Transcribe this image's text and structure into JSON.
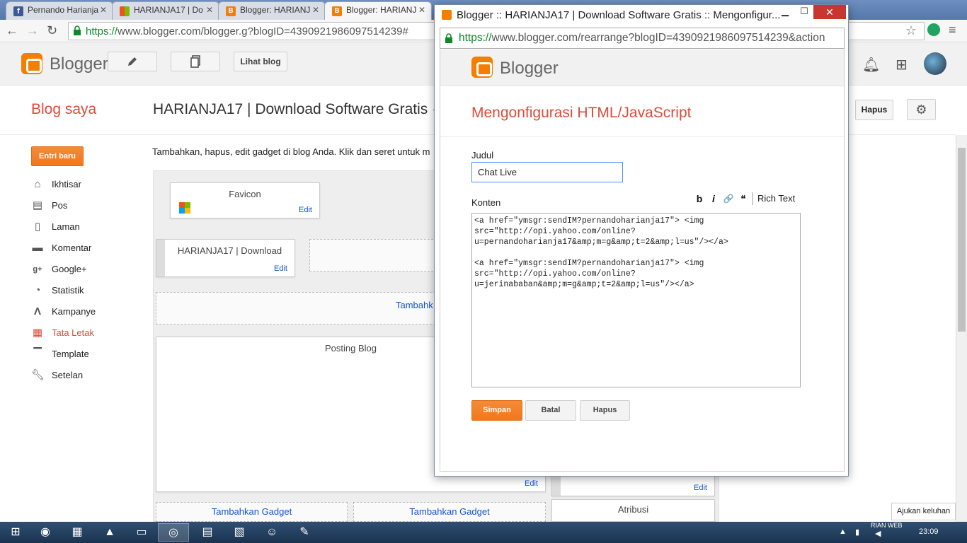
{
  "browser": {
    "tabs": [
      {
        "label": "Pernando Harianja",
        "icon": "facebook-icon"
      },
      {
        "label": "HARIANJA17 | Do",
        "icon": "windows-icon"
      },
      {
        "label": "Blogger: HARIANJ",
        "icon": "blogger-icon"
      },
      {
        "label": "Blogger: HARIANJ",
        "icon": "blogger-icon"
      }
    ],
    "url_secure": "https://",
    "url_rest": "www.blogger.com/blogger.g?blogID=4390921986097514239#"
  },
  "header": {
    "brand": "Blogger",
    "lihat_blog": "Lihat blog"
  },
  "sidebar": {
    "title": "Blog saya",
    "new_post": "Entri baru",
    "items": [
      {
        "label": "Ikhtisar",
        "icon": "home-icon"
      },
      {
        "label": "Pos",
        "icon": "posts-icon"
      },
      {
        "label": "Laman",
        "icon": "pages-icon"
      },
      {
        "label": "Komentar",
        "icon": "comments-icon"
      },
      {
        "label": "Google+",
        "icon": "google-plus-icon"
      },
      {
        "label": "Statistik",
        "icon": "stats-icon"
      },
      {
        "label": "Kampanye",
        "icon": "campaign-icon"
      },
      {
        "label": "Tata Letak",
        "icon": "layout-icon"
      },
      {
        "label": "Template",
        "icon": "template-icon"
      },
      {
        "label": "Setelan",
        "icon": "settings-icon"
      }
    ]
  },
  "main": {
    "blog_title": "HARIANJA17 | Download Software Gratis  ·",
    "hapus": "Hapus",
    "intro": "Tambahkan, hapus, edit gadget di blog Anda. Klik dan seret untuk m",
    "gadgets": {
      "favicon": "Favicon",
      "header": "HARIANJA17 | Download",
      "posting": "Posting Blog",
      "atribusi": "Atribusi",
      "edit": "Edit",
      "tambah": "Tambahkan Gadget",
      "tambah_partial": "Tambahk"
    },
    "feedback": "Ajukan keluhan"
  },
  "popup": {
    "window_title": "Blogger :: HARIANJA17 | Download Software Gratis :: Mengonfigur...",
    "url_secure": "https://",
    "url_rest": "www.blogger.com/rearrange?blogID=4390921986097514239&action",
    "brand": "Blogger",
    "heading": "Mengonfigurasi HTML/JavaScript",
    "judul_label": "Judul",
    "judul_value": "Chat Live",
    "konten_label": "Konten",
    "rich_text": "Rich Text",
    "format_buttons": [
      "b",
      "i",
      "🔗",
      "❝"
    ],
    "konten_value": "<a href=\"ymsgr:sendIM?pernandoharianja17\"> <img\nsrc=\"http://opi.yahoo.com/online?\nu=pernandoharianja17&amp;m=g&amp;t=2&amp;l=us\"/></a>\n\n<a href=\"ymsgr:sendIM?pernandoharianja17\"> <img\nsrc=\"http://opi.yahoo.com/online?\nu=jerinababan&amp;m=g&amp;t=2&amp;l=us\"/></a>",
    "simpan": "Simpan",
    "batal": "Batal",
    "hapus": "Hapus"
  },
  "taskbar": {
    "clock": "23:09",
    "tray_text": "RIAN WEB"
  },
  "colors": {
    "accent_orange": "#f57d00",
    "title_red": "#dd4b39",
    "link_blue": "#1155cc"
  }
}
